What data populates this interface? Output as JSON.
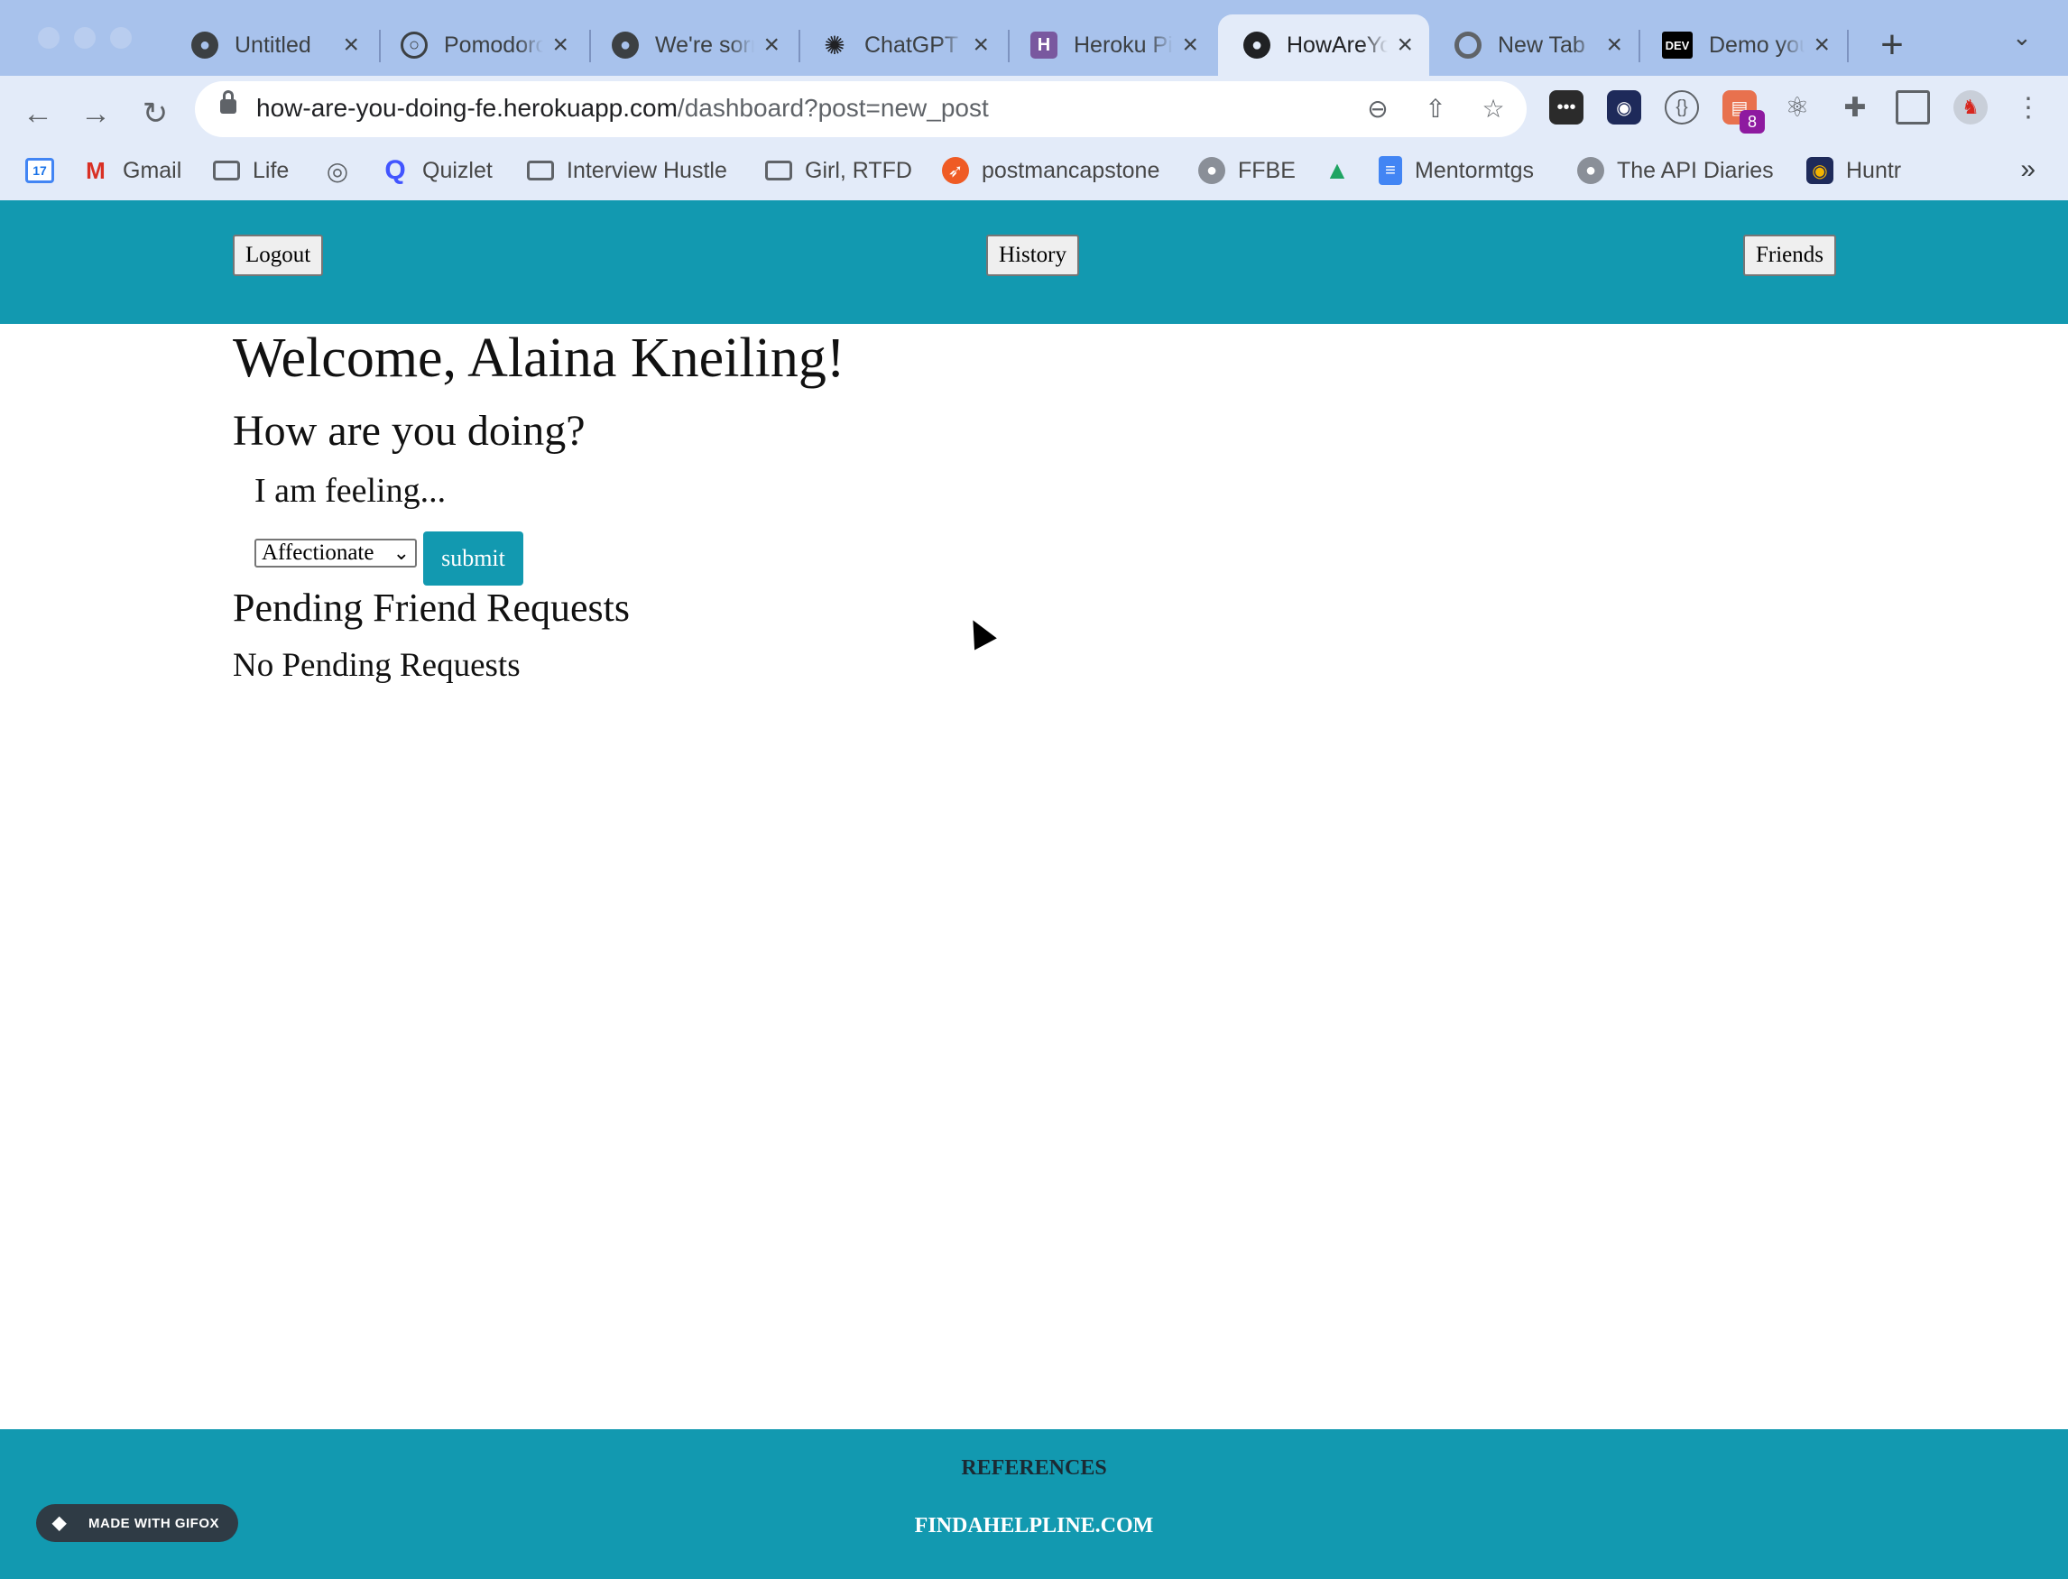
{
  "browser": {
    "tabs": [
      {
        "title": "Untitled",
        "icon": "globe-icon"
      },
      {
        "title": "Pomodoro",
        "icon": "pomodoro-icon"
      },
      {
        "title": "We're sorry",
        "icon": "globe-icon"
      },
      {
        "title": "ChatGPT",
        "icon": "openai-icon"
      },
      {
        "title": "Heroku Pipeline",
        "icon": "heroku-icon"
      },
      {
        "title": "HowAreYouDoing",
        "icon": "globe-icon",
        "active": true
      },
      {
        "title": "New Tab",
        "icon": "chrome-icon"
      },
      {
        "title": "Demo your",
        "icon": "dev-icon"
      }
    ],
    "url_host": "how-are-you-doing-fe.herokuapp.com",
    "url_path": "/dashboard?post=new_post",
    "extension_badge": "8",
    "bookmarks": [
      {
        "label": "",
        "icon": "calendar-icon"
      },
      {
        "label": "Gmail",
        "icon": "gmail-icon"
      },
      {
        "label": "Life",
        "icon": "folder-icon"
      },
      {
        "label": "",
        "icon": "pomodoro-icon"
      },
      {
        "label": "Quizlet",
        "icon": "quizlet-icon"
      },
      {
        "label": "Interview Hustle",
        "icon": "folder-icon"
      },
      {
        "label": "Girl, RTFD",
        "icon": "folder-icon"
      },
      {
        "label": "postmancapstone",
        "icon": "postman-icon"
      },
      {
        "label": "FFBE",
        "icon": "github-icon"
      },
      {
        "label": "",
        "icon": "google-drive-icon"
      },
      {
        "label": "Mentormtgs",
        "icon": "google-docs-icon"
      },
      {
        "label": "The API Diaries",
        "icon": "github-icon"
      },
      {
        "label": "Huntr",
        "icon": "huntr-icon"
      }
    ],
    "bookmarks_more": "»",
    "calendar_day": "17",
    "dev_logo": "DEV",
    "colors": {
      "tabstrip": "#a8c2ec",
      "toolbar": "#e3ebf9"
    }
  },
  "header": {
    "logout": "Logout",
    "history": "History",
    "friends": "Friends"
  },
  "main": {
    "welcome": "Welcome, Alaina Kneiling!",
    "question": "How are you doing?",
    "feeling_label": "I am feeling...",
    "feeling_selected": "Affectionate",
    "submit": "submit",
    "pending_title": "Pending Friend Requests",
    "no_pending": "No Pending Requests"
  },
  "footer": {
    "references": "REFERENCES",
    "helpline": "FINDAHELPLINE.COM"
  },
  "gifox_badge": "MADE WITH GIFOX",
  "colors": {
    "accent": "#1299b0"
  }
}
